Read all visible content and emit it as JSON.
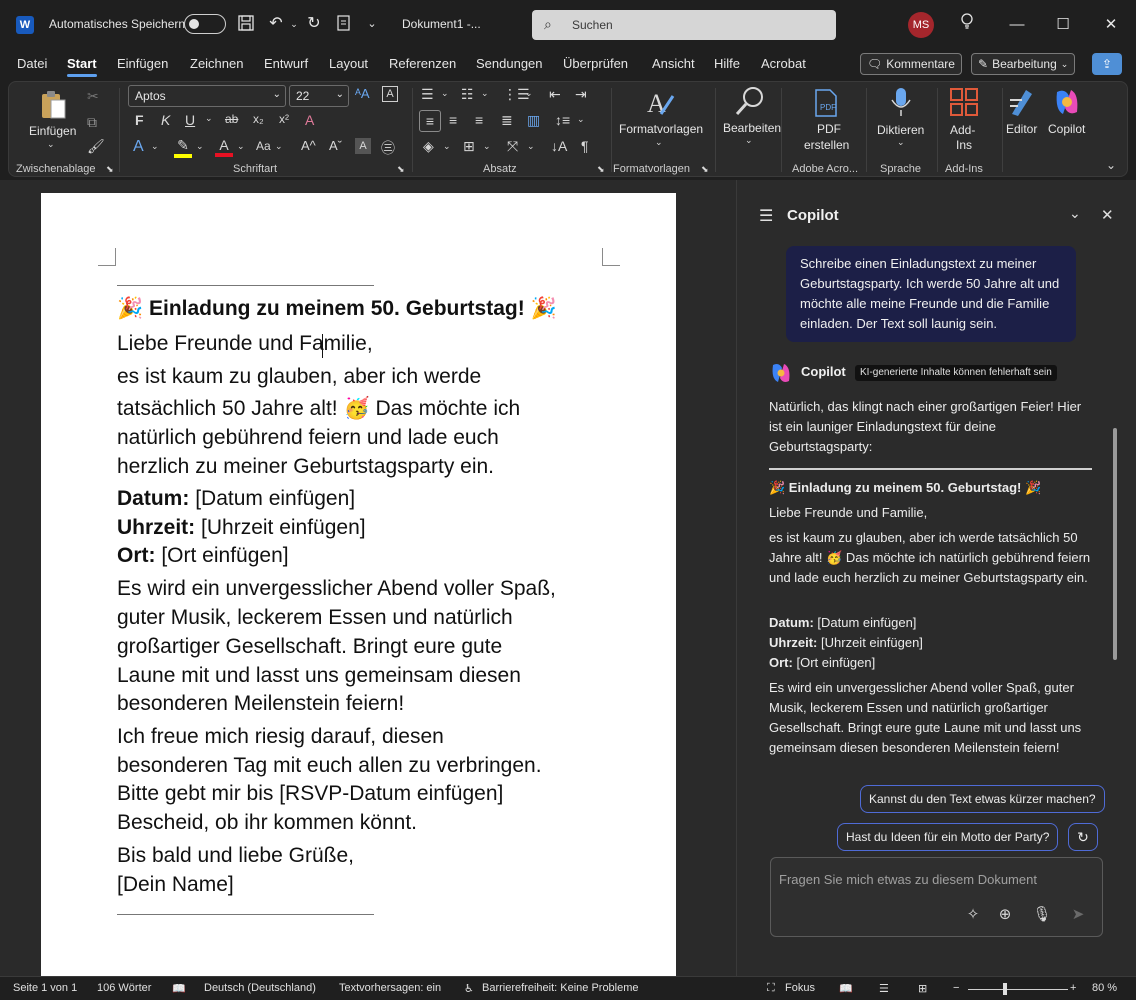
{
  "titlebar": {
    "app_letter": "W",
    "autosave_label": "Automatisches Speichern",
    "doc_title": "Dokument1 -...",
    "search_placeholder": "Suchen",
    "avatar_initials": "MS"
  },
  "menu": {
    "tabs": [
      "Datei",
      "Start",
      "Einfügen",
      "Zeichnen",
      "Entwurf",
      "Layout",
      "Referenzen",
      "Sendungen",
      "Überprüfen",
      "Ansicht",
      "Hilfe",
      "Acrobat"
    ],
    "active_tab": "Start",
    "comments_label": "Kommentare",
    "edit_label": "Bearbeitung"
  },
  "ribbon": {
    "paste_label": "Einfügen",
    "font_name": "Aptos",
    "font_size": "22",
    "styles_label": "Formatvorlagen",
    "edit_label": "Bearbeiten",
    "pdf_label_1": "PDF",
    "pdf_label_2": "erstellen",
    "dictate_label": "Diktieren",
    "addins_label_1": "Add-",
    "addins_label_2": "Ins",
    "editor_label": "Editor",
    "copilot_label": "Copilot",
    "groups": {
      "clipboard": "Zwischenablage",
      "font": "Schriftart",
      "paragraph": "Absatz",
      "styles": "Formatvorlagen",
      "adobe": "Adobe Acro...",
      "speech": "Sprache",
      "addins": "Add-Ins"
    }
  },
  "document": {
    "title": "Einladung zu meinem 50. Geburtstag!",
    "greeting": "Liebe Freunde und Familie,",
    "intro_lines": [
      "es ist kaum zu glauben, aber ich werde",
      "tatsächlich 50 Jahre alt! 🥳 Das möchte ich",
      "natürlich gebührend feiern und lade euch",
      "herzlich zu meiner Geburtstagsparty ein."
    ],
    "date_label": "Datum:",
    "date_value": "[Datum einfügen]",
    "time_label": "Uhrzeit:",
    "time_value": "[Uhrzeit einfügen]",
    "place_label": "Ort:",
    "place_value": "[Ort einfügen]",
    "body_lines": [
      "Es wird ein unvergesslicher Abend voller Spaß,",
      "guter Musik, leckerem Essen und natürlich",
      "großartiger Gesellschaft. Bringt eure gute",
      "Laune mit und lasst uns gemeinsam diesen",
      "besonderen Meilenstein feiern!"
    ],
    "closing_lines": [
      "Ich freue mich riesig darauf, diesen",
      "besonderen Tag mit euch allen zu verbringen.",
      "Bitte gebt mir bis [RSVP-Datum einfügen]",
      "Bescheid, ob ihr kommen könnt."
    ],
    "signoff_lines": [
      "Bis bald und liebe Grüße,",
      "[Dein Name]"
    ]
  },
  "copilot": {
    "title": "Copilot",
    "user_message": "Schreibe einen Einladungstext zu meiner Geburtstagsparty. Ich werde 50 Jahre alt und möchte alle meine Freunde und die Familie einladen. Der Text soll launig sein.",
    "assistant_name": "Copilot",
    "ai_disclaimer": "KI-generierte Inhalte können fehlerhaft sein",
    "reply_intro": "Natürlich, das klingt nach einer großartigen Feier! Hier ist ein launiger Einladungstext für deine Geburtstagsparty:",
    "reply_title": "🎉 Einladung zu meinem 50. Geburtstag! 🎉",
    "reply_greeting": "Liebe Freunde und Familie,",
    "reply_intro_text": "es ist kaum zu glauben, aber ich werde tatsächlich 50 Jahre alt! 🥳 Das möchte ich natürlich gebührend feiern und lade euch herzlich zu meiner Geburtstagsparty ein.",
    "reply_date_label": "Datum:",
    "reply_date_value": "[Datum einfügen]",
    "reply_time_label": "Uhrzeit:",
    "reply_time_value": "[Uhrzeit einfügen]",
    "reply_place_label": "Ort:",
    "reply_place_value": "[Ort einfügen]",
    "reply_body": "Es wird ein unvergesslicher Abend voller Spaß, guter Musik, leckerem Essen und natürlich großartiger Gesellschaft. Bringt eure gute Laune mit und lasst uns gemeinsam diesen besonderen Meilenstein feiern!",
    "suggestion_1": "Kannst du den Text etwas kürzer machen?",
    "suggestion_2": "Hast du Ideen für ein Motto der Party?",
    "input_placeholder": "Fragen Sie mich etwas zu diesem Dokument"
  },
  "statusbar": {
    "page": "Seite 1 von 1",
    "words": "106 Wörter",
    "language": "Deutsch (Deutschland)",
    "predictions": "Textvorhersagen: ein",
    "accessibility": "Barrierefreiheit: Keine Probleme",
    "focus": "Fokus",
    "zoom": "80 %"
  },
  "colors": {
    "accent": "#5ea0ef",
    "user_bubble": "#1c1f47",
    "avatar": "#a4262c"
  }
}
